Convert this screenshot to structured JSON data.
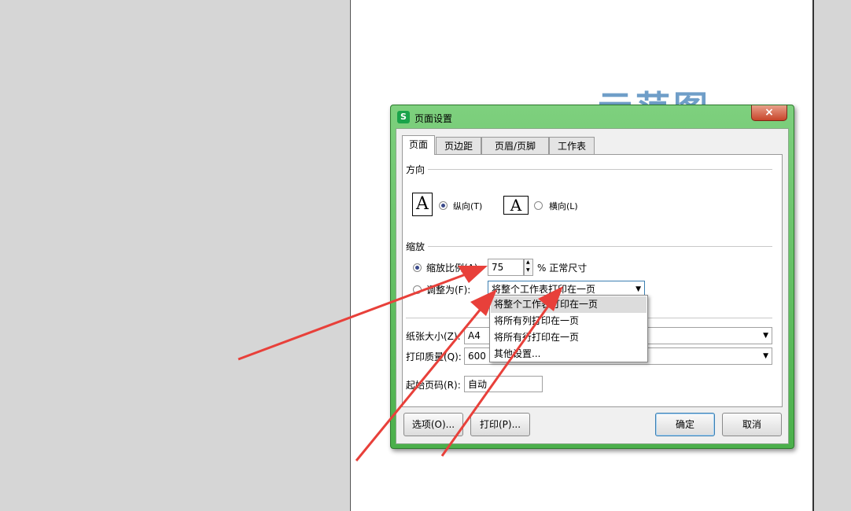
{
  "background": {
    "watermark": "示范图"
  },
  "dialog": {
    "title": "页面设置",
    "app_icon": "S",
    "close_label": "×",
    "tabs": [
      {
        "label": "页面"
      },
      {
        "label": "页边距"
      },
      {
        "label": "页眉/页脚"
      },
      {
        "label": "工作表"
      }
    ],
    "orientation": {
      "group_label": "方向",
      "icon_glyph": "A",
      "portrait_label": "纵向(T)",
      "landscape_label": "横向(L)",
      "selected": "portrait"
    },
    "scaling": {
      "group_label": "缩放",
      "ratio_label": "缩放比例(A):",
      "ratio_value": "75",
      "ratio_suffix": "% 正常尺寸",
      "fit_label": "调整为(F):",
      "fit_value": "将整个工作表打印在一页",
      "selected": "ratio"
    },
    "dropdown_options": [
      "将整个工作表打印在一页",
      "将所有列打印在一页",
      "将所有行打印在一页",
      "其他设置..."
    ],
    "paper_size": {
      "label": "纸张大小(Z):",
      "value": "A4"
    },
    "print_quality": {
      "label": "打印质量(Q):",
      "value": "600 点/英寸"
    },
    "start_page": {
      "label": "起始页码(R):",
      "value": "自动"
    },
    "buttons": {
      "options": "选项(O)...",
      "print": "打印(P)...",
      "ok": "确定",
      "cancel": "取消"
    },
    "spinner_up": "▲",
    "spinner_down": "▼",
    "select_arrow": "▼"
  },
  "colors": {
    "dialog_frame": "#4bb04b",
    "annotation_arrow": "#e8403a",
    "watermark": "#6f9ec8"
  }
}
